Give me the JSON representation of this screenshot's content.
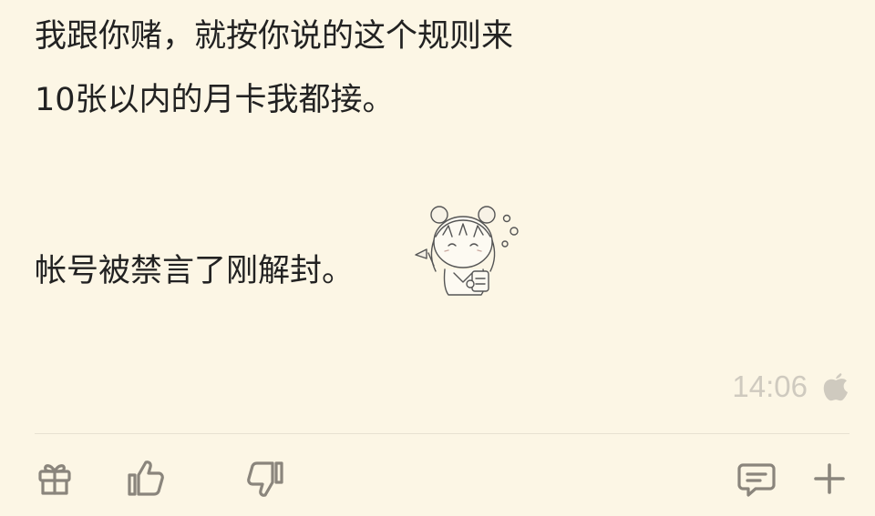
{
  "post": {
    "lines": [
      "我跟你赌，就按你说的这个规则来",
      "10张以内的月卡我都接。",
      "帐号被禁言了刚解封。"
    ],
    "sticker": "chibi-girl-sticker",
    "timestamp": "14:06",
    "platform_icon": "apple-icon"
  },
  "actions": {
    "gift": "gift-icon",
    "like": "thumbs-up-icon",
    "dislike": "thumbs-down-icon",
    "comment": "comment-icon",
    "add": "plus-icon"
  },
  "colors": {
    "background": "#fcf6e5",
    "text": "#222222",
    "muted": "#cfcabf",
    "icon": "#8a857c"
  }
}
